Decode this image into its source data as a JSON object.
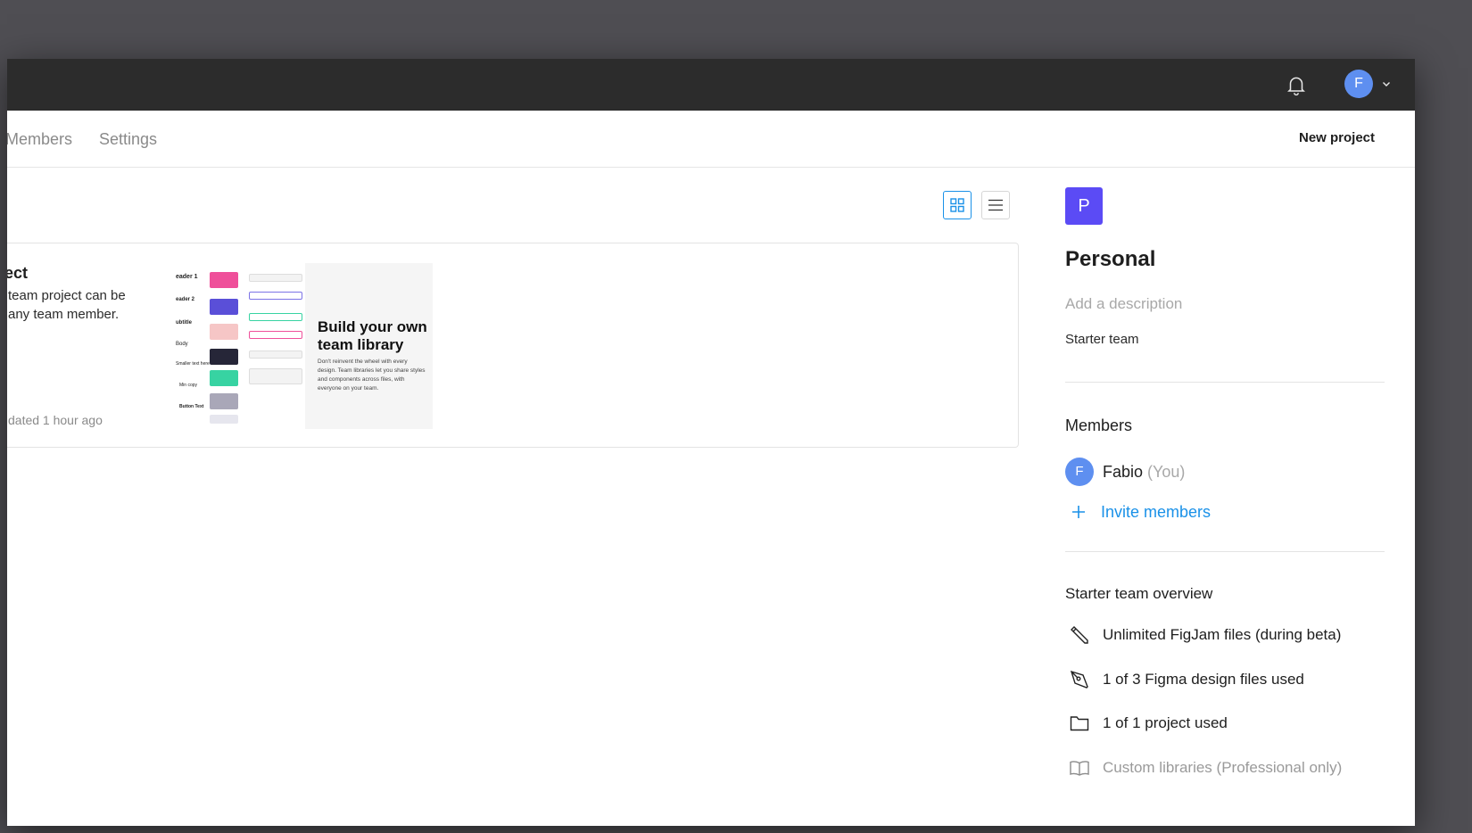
{
  "topbar": {
    "user_initial": "F"
  },
  "subnav": {
    "tabs": [
      "Members",
      "Settings"
    ],
    "new_project_label": "New project"
  },
  "card": {
    "title": "ect",
    "description": "team project can be any team member.",
    "updated": "dated 1 hour ago",
    "thumbnail": {
      "title": "Build your own team library",
      "description": "Don't reinvent the wheel with every design. Team libraries let you share styles and components across files, with everyone on your team.",
      "mini_labels": [
        "eader 1",
        "eader 2",
        "ubtitle",
        "Body",
        "Smaller text here",
        "Min copy",
        "Button Text"
      ]
    }
  },
  "panel": {
    "avatar_initial": "P",
    "team_name": "Personal",
    "description_placeholder": "Add a description",
    "plan": "Starter team",
    "members_heading": "Members",
    "member": {
      "initial": "F",
      "name": "Fabio",
      "you_tag": "(You)"
    },
    "invite_label": "Invite members",
    "overview_heading": "Starter team overview",
    "overview": [
      {
        "icon": "pencil-icon",
        "text": "Unlimited FigJam files (during beta)"
      },
      {
        "icon": "pen-tool-icon",
        "text": "1 of 3 Figma design files used"
      },
      {
        "icon": "folder-icon",
        "text": "1 of 1 project used"
      },
      {
        "icon": "book-icon",
        "text": "Custom libraries (Professional only)"
      }
    ]
  },
  "colors": {
    "topbar": "#2c2c2c",
    "accent_blue": "#1a91e8",
    "team_avatar": "#5b4bf5",
    "user_avatar": "#5e8ff0"
  }
}
